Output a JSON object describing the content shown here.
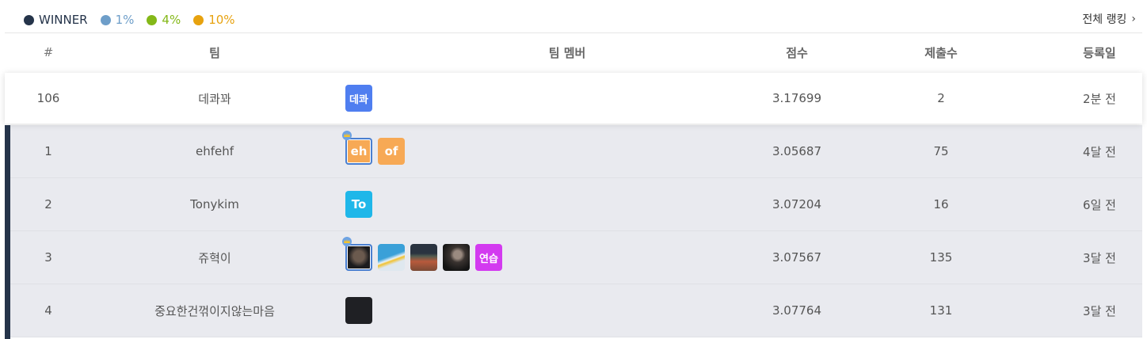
{
  "legend": [
    {
      "label": "WINNER",
      "color": "#25344a"
    },
    {
      "label": "1%",
      "color": "#6e9ec9"
    },
    {
      "label": "4%",
      "color": "#84b818"
    },
    {
      "label": "10%",
      "color": "#e7a20f"
    }
  ],
  "all_ranking_label": "전체 랭킹",
  "columns": {
    "num": "#",
    "team": "팀",
    "members": "팀 멤버",
    "score": "점수",
    "submissions": "제출수",
    "registered": "등록일"
  },
  "my_row": {
    "rank": "106",
    "team": "데콰꽈",
    "score": "3.17699",
    "submissions": "2",
    "date": "2분 전",
    "members": [
      {
        "text": "데콰",
        "color": "#4f7ef0"
      }
    ]
  },
  "rows": [
    {
      "rank": "1",
      "team": "ehfehf",
      "score": "3.05687",
      "submissions": "75",
      "date": "4달 전",
      "members": [
        {
          "text": "eh",
          "color": "#f7a955",
          "leader": true
        },
        {
          "text": "of",
          "color": "#f7a955"
        }
      ]
    },
    {
      "rank": "2",
      "team": "Tonykim",
      "score": "3.07204",
      "submissions": "16",
      "date": "6일 전",
      "members": [
        {
          "text": "To",
          "color": "#1fb7e9"
        }
      ]
    },
    {
      "rank": "3",
      "team": "쥬혁이",
      "score": "3.07567",
      "submissions": "135",
      "date": "3달 전",
      "members": [
        {
          "photo": "dark-portrait",
          "leader": true
        },
        {
          "photo": "ski-photo"
        },
        {
          "photo": "track-photo"
        },
        {
          "photo": "night-photo"
        },
        {
          "text": "연습",
          "color": "#d33af0"
        }
      ]
    },
    {
      "rank": "4",
      "team": "중요한건꺾이지않는마음",
      "score": "3.07764",
      "submissions": "131",
      "date": "3달 전",
      "members": [
        {
          "photo": "black-square"
        }
      ]
    }
  ]
}
